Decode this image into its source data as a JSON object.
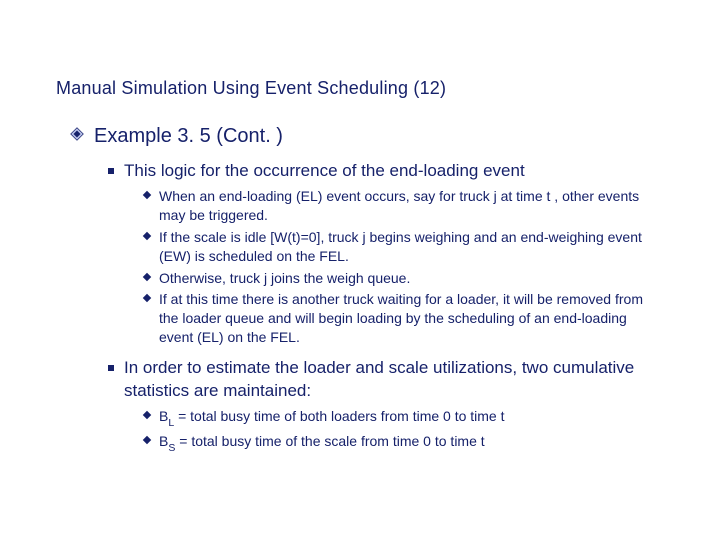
{
  "title": "Manual Simulation Using Event Scheduling (12)",
  "lvl1": {
    "text": "Example 3. 5 (Cont. )"
  },
  "lvl2a": {
    "text": "This logic for the occurrence of the end-loading event"
  },
  "lvl3a": "When an end-loading (EL) event occurs, say for truck j at time t , other events may be triggered.",
  "lvl3b": "If the scale is idle [W(t)=0], truck j begins weighing and an end-weighing event (EW) is scheduled on the FEL.",
  "lvl3c": "Otherwise, truck j joins the weigh queue.",
  "lvl3d": "If at this time there is another truck waiting for a loader, it will be removed from the loader queue and will begin loading by the scheduling of an end-loading event (EL) on the FEL.",
  "lvl2b": {
    "text": "In order to estimate the loader and scale utilizations, two cumulative statistics are maintained:"
  },
  "stats": {
    "bl_prefix": "B",
    "bl_sub": "L",
    "bl_rest": " = total busy time of both loaders from time 0 to time t",
    "bs_prefix": "B",
    "bs_sub": "S",
    "bs_rest": " = total busy time of the scale from time 0 to time t"
  }
}
